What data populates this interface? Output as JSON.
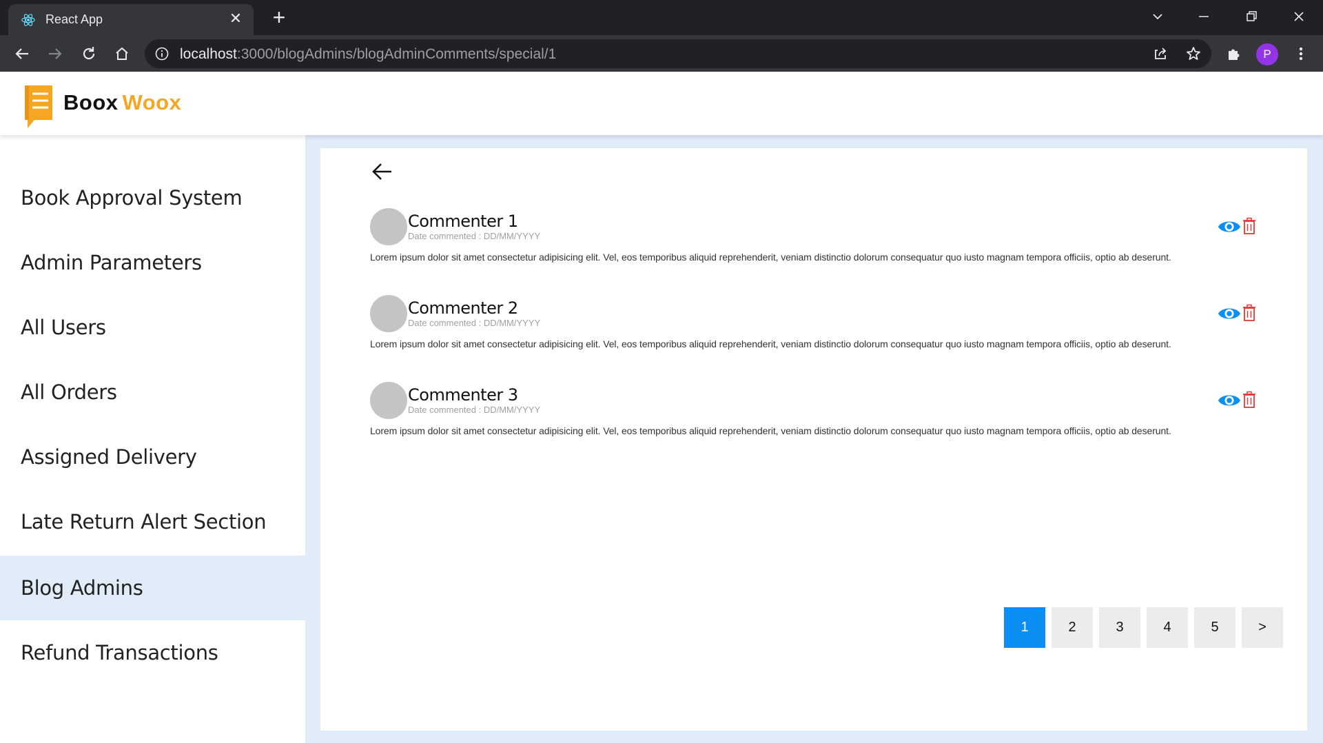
{
  "browser": {
    "tab_title": "React App",
    "tab_close": "✕",
    "new_tab": "+",
    "url_host": "localhost",
    "url_path": ":3000/blogAdmins/blogAdminComments/special/1",
    "profile_initial": "P"
  },
  "brand": {
    "name_part1": "Boox",
    "name_part2": "Woox",
    "accent_color": "#f5a623"
  },
  "sidebar": {
    "items": [
      {
        "label": "Book Approval System"
      },
      {
        "label": "Admin Parameters"
      },
      {
        "label": "All Users"
      },
      {
        "label": "All Orders"
      },
      {
        "label": "Assigned Delivery"
      },
      {
        "label": "Late Return Alert Section"
      },
      {
        "label": "Blog Admins"
      },
      {
        "label": "Refund Transactions"
      }
    ],
    "active_index": 6
  },
  "comments": [
    {
      "name": "Commenter 1",
      "date": "Date commented : DD/MM/YYYY",
      "text": "Lorem ipsum dolor sit amet consectetur adipisicing elit. Vel, eos temporibus aliquid reprehenderit, veniam distinctio dolorum consequatur quo iusto magnam tempora officiis, optio ab deserunt."
    },
    {
      "name": "Commenter 2",
      "date": "Date commented : DD/MM/YYYY",
      "text": "Lorem ipsum dolor sit amet consectetur adipisicing elit. Vel, eos temporibus aliquid reprehenderit, veniam distinctio dolorum consequatur quo iusto magnam tempora officiis, optio ab deserunt."
    },
    {
      "name": "Commenter 3",
      "date": "Date commented : DD/MM/YYYY",
      "text": "Lorem ipsum dolor sit amet consectetur adipisicing elit. Vel, eos temporibus aliquid reprehenderit, veniam distinctio dolorum consequatur quo iusto magnam tempora officiis, optio ab deserunt."
    }
  ],
  "pagination": {
    "pages": [
      "1",
      "2",
      "3",
      "4",
      "5"
    ],
    "next": ">",
    "current": "1",
    "accent_color": "#0b8ff2"
  },
  "colors": {
    "eye_icon": "#0b8ff2",
    "trash_icon": "#e53935",
    "main_background": "#e0ecf8"
  }
}
